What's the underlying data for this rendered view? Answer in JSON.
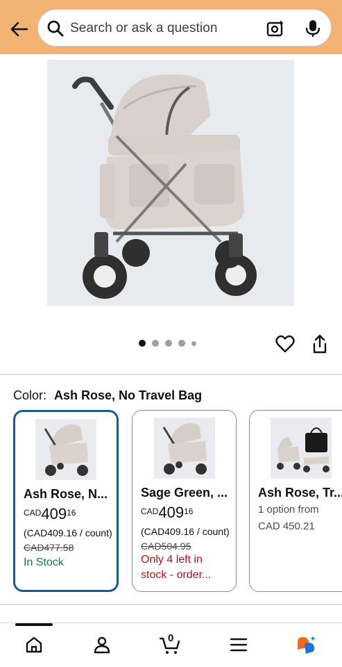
{
  "search": {
    "placeholder": "Search or ask a question"
  },
  "color_selector": {
    "label": "Color:",
    "selected": "Ash Rose, No Travel Bag"
  },
  "carousel": {
    "total": 5,
    "active": 1
  },
  "variants": [
    {
      "name": "Ash Rose, N...",
      "currency": "CAD",
      "whole": "409",
      "fraction": "16",
      "unit_price": "(CAD409.16 / count)",
      "list_price": "CAD477.58",
      "stock": "In Stock",
      "selected": true
    },
    {
      "name": "Sage Green, ...",
      "currency": "CAD",
      "whole": "409",
      "fraction": "16",
      "unit_price": "(CAD409.16 / count)",
      "list_price": "CAD504.95",
      "stock_line1": "Only 4 left in",
      "stock_line2": "stock - order..."
    },
    {
      "name": "Ash Rose, Tr...",
      "options": "1 option from",
      "from_price": "CAD 450.21"
    }
  ],
  "nav": {
    "cart_count": "0",
    "items": [
      "home-icon",
      "account-icon",
      "cart-icon",
      "menu-icon",
      "rufus-icon"
    ]
  },
  "colors": {
    "header_bg": "#f3b373",
    "selected_border": "#1a5a8a",
    "in_stock": "#117a3a",
    "low_stock": "#b3121a"
  }
}
